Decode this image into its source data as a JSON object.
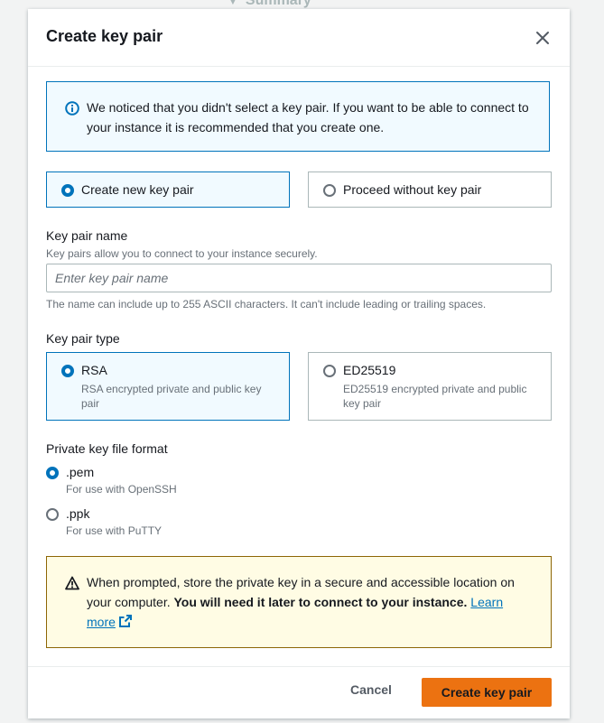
{
  "background": {
    "summary_label": "Summary"
  },
  "modal": {
    "title": "Create key pair",
    "info_text": "We noticed that you didn't select a key pair. If you want to be able to connect to your instance it is recommended that you create one.",
    "mode_options": {
      "create_label": "Create new key pair",
      "proceed_label": "Proceed without key pair",
      "selected": "create"
    },
    "name_field": {
      "label": "Key pair name",
      "description": "Key pairs allow you to connect to your instance securely.",
      "placeholder": "Enter key pair name",
      "value": "",
      "constraint": "The name can include up to 255 ASCII characters. It can't include leading or trailing spaces."
    },
    "key_type": {
      "label": "Key pair type",
      "rsa_label": "RSA",
      "rsa_desc": "RSA encrypted private and public key pair",
      "ed_label": "ED25519",
      "ed_desc": "ED25519 encrypted private and public key pair",
      "selected": "RSA"
    },
    "file_format": {
      "label": "Private key file format",
      "pem_label": ".pem",
      "pem_desc": "For use with OpenSSH",
      "ppk_label": ".ppk",
      "ppk_desc": "For use with PuTTY",
      "selected": ".pem"
    },
    "warning": {
      "text": "When prompted, store the private key in a secure and accessible location on your computer. ",
      "bold": "You will need it later to connect to your instance.",
      "link_word1": "Learn",
      "link_word2": "more"
    },
    "footer": {
      "cancel_label": "Cancel",
      "create_label": "Create key pair"
    }
  },
  "colors": {
    "accent_blue": "#0073bb",
    "primary_orange": "#ec7211",
    "warning_border": "#8d6605"
  }
}
